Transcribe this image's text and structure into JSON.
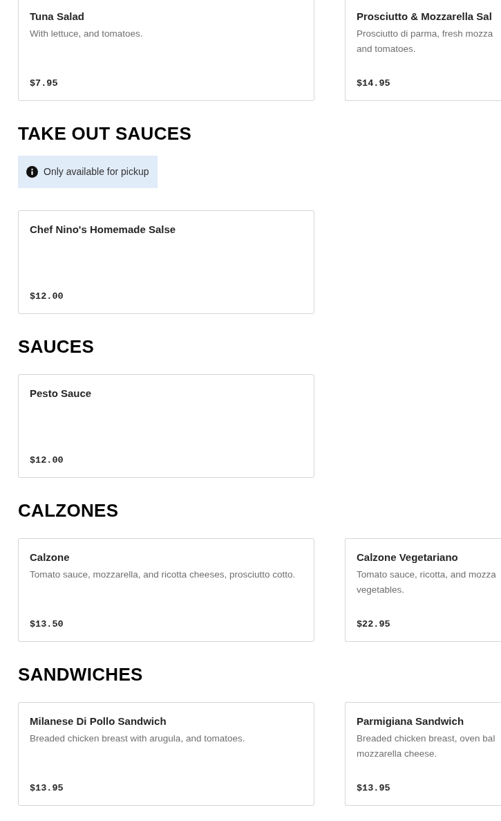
{
  "sections": [
    {
      "items": [
        {
          "name": "Tuna Salad",
          "description": "With lettuce, and tomatoes.",
          "price": "$7.95"
        },
        {
          "name": "Prosciutto & Mozzarella Sal",
          "description": "Prosciutto di parma, fresh mozza\nand tomatoes.",
          "price": "$14.95"
        }
      ]
    },
    {
      "title": "TAKE OUT SAUCES",
      "notice": "Only available for pickup",
      "items": [
        {
          "name": "Chef Nino's Homemade Salse",
          "price": "$12.00"
        }
      ]
    },
    {
      "title": "SAUCES",
      "items": [
        {
          "name": "Pesto Sauce",
          "price": "$12.00"
        }
      ]
    },
    {
      "title": "CALZONES",
      "items": [
        {
          "name": "Calzone",
          "description": "Tomato sauce, mozzarella, and ricotta cheeses, prosciutto cotto.",
          "price": "$13.50"
        },
        {
          "name": "Calzone Vegetariano",
          "description": "Tomato sauce, ricotta, and mozza\nvegetables.",
          "price": "$22.95"
        }
      ]
    },
    {
      "title": "SANDWICHES",
      "items": [
        {
          "name": "Milanese Di Pollo Sandwich",
          "description": "Breaded chicken breast with arugula, and tomatoes.",
          "price": "$13.95"
        },
        {
          "name": "Parmigiana Sandwich",
          "description": "Breaded chicken breast, oven bal\nmozzarella cheese.",
          "price": "$13.95"
        }
      ]
    }
  ]
}
